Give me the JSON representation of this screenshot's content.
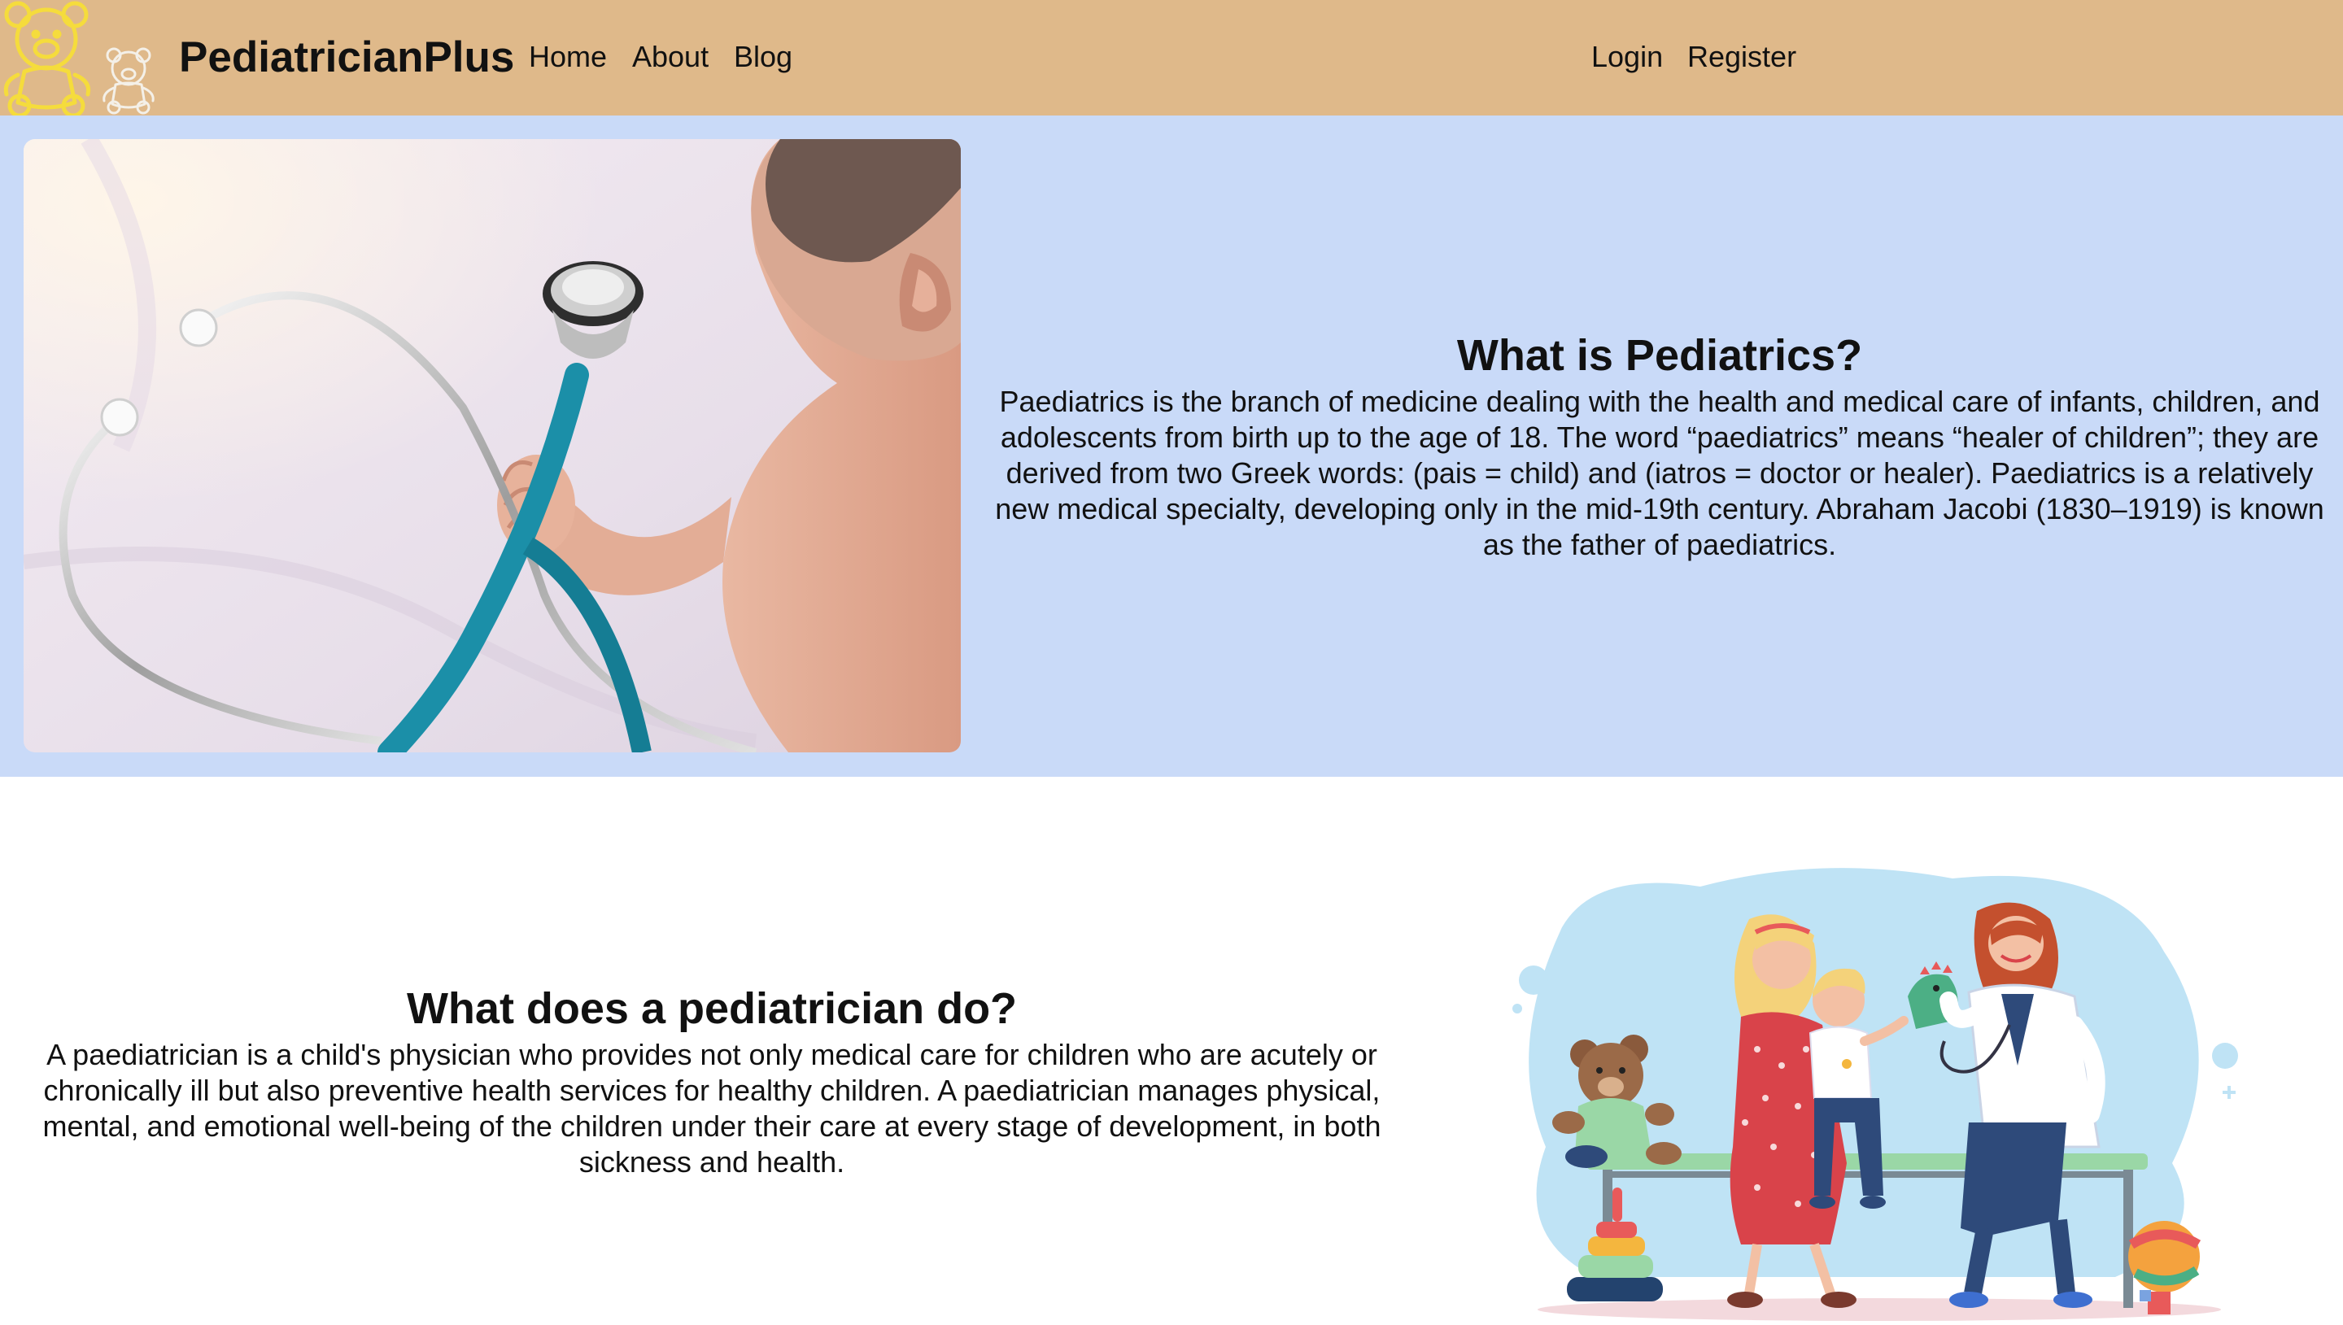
{
  "navbar": {
    "brand": "PediatricianPlus",
    "links": [
      "Home",
      "About",
      "Blog"
    ],
    "auth": [
      "Login",
      "Register"
    ]
  },
  "hero": {
    "title": "What is Pediatrics?",
    "body": "Paediatrics is the branch of medicine dealing with the health and medical care of infants, children, and adolescents from birth up to the age of 18. The word “paediatrics” means “healer of children”; they are derived from two Greek words: (pais = child) and (iatros = doctor or healer). Paediatrics is a relatively new medical specialty, developing only in the mid-19th century. Abraham Jacobi (1830–1919) is known as the father of paediatrics."
  },
  "section2": {
    "title": "What does a pediatrician do?",
    "body": "A paediatrician is a child's physician who provides not only medical care for children who are acutely or chronically ill but also preventive health services for healthy children. A paediatrician manages physical, mental, and emotional well-being of the children under their care at every stage of development, in both sickness and health."
  },
  "icons": {
    "logo_primary": "teddy-bear-icon",
    "logo_secondary": "teddy-bear-outline-icon"
  },
  "colors": {
    "navbar_bg": "#dfb98a",
    "hero_bg": "#c9daf8",
    "logo_yellow": "#f5dc3c",
    "stethoscope_teal": "#1b8fa8"
  }
}
